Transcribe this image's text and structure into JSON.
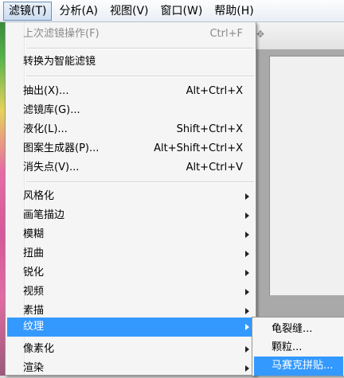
{
  "menubar": {
    "items": [
      {
        "label": "滤镜(T)",
        "active": true
      },
      {
        "label": "分析(A)",
        "active": false
      },
      {
        "label": "视图(V)",
        "active": false
      },
      {
        "label": "窗口(W)",
        "active": false
      },
      {
        "label": "帮助(H)",
        "active": false
      }
    ]
  },
  "filter_menu": {
    "last_filter": {
      "label": "上次滤镜操作(F)",
      "shortcut": "Ctrl+F",
      "disabled": true
    },
    "smart_filter": {
      "label": "转换为智能滤镜"
    },
    "commands": [
      {
        "label": "抽出(X)...",
        "shortcut": "Alt+Ctrl+X"
      },
      {
        "label": "滤镜库(G)...",
        "shortcut": ""
      },
      {
        "label": "液化(L)...",
        "shortcut": "Shift+Ctrl+X"
      },
      {
        "label": "图案生成器(P)...",
        "shortcut": "Alt+Shift+Ctrl+X"
      },
      {
        "label": "消失点(V)...",
        "shortcut": "Alt+Ctrl+V"
      }
    ],
    "categories": [
      {
        "label": "风格化",
        "highlighted": false
      },
      {
        "label": "画笔描边",
        "highlighted": false
      },
      {
        "label": "模糊",
        "highlighted": false
      },
      {
        "label": "扭曲",
        "highlighted": false
      },
      {
        "label": "锐化",
        "highlighted": false
      },
      {
        "label": "视频",
        "highlighted": false
      },
      {
        "label": "素描",
        "highlighted": false
      },
      {
        "label": "纹理",
        "highlighted": true
      },
      {
        "label": "像素化",
        "highlighted": false
      },
      {
        "label": "渲染",
        "highlighted": false
      }
    ]
  },
  "texture_submenu": {
    "items": [
      {
        "label": "龟裂缝...",
        "highlighted": false
      },
      {
        "label": "颗粒...",
        "highlighted": false
      },
      {
        "label": "马赛克拼贴...",
        "highlighted": true
      }
    ]
  },
  "background": {
    "toolbar_icon": "move-icon"
  },
  "colors": {
    "highlight": "#3399ff",
    "menu_bg": "#f5f5f5",
    "disabled_text": "#8a8a8a"
  }
}
